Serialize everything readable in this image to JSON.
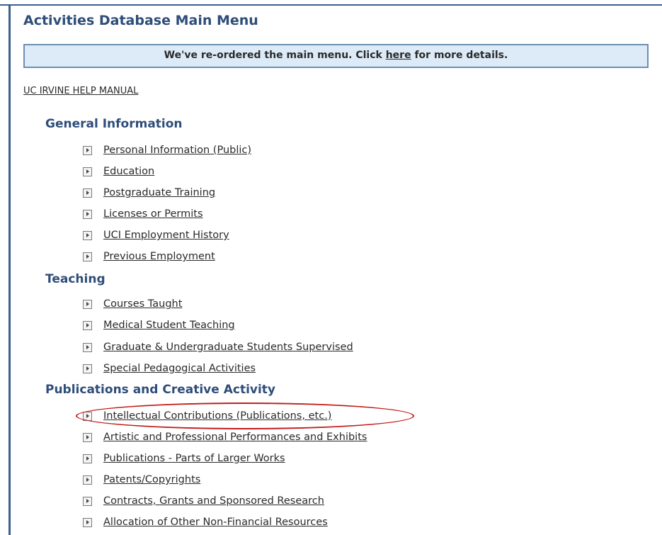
{
  "page": {
    "title": "Activities Database Main Menu"
  },
  "notice": {
    "text_before": "We've re-ordered the main menu. Click ",
    "link_label": "here",
    "text_after": " for more details."
  },
  "manual_link": {
    "label": "UC IRVINE HELP MANUAL"
  },
  "sections": [
    {
      "heading": "General Information",
      "items": [
        {
          "label": "Personal Information (Public)",
          "icon": "arrow-right-icon"
        },
        {
          "label": "Education",
          "icon": "arrow-right-icon"
        },
        {
          "label": "Postgraduate Training",
          "icon": "arrow-right-icon"
        },
        {
          "label": "Licenses or Permits",
          "icon": "arrow-right-icon"
        },
        {
          "label": "UCI Employment History",
          "icon": "arrow-right-icon"
        },
        {
          "label": "Previous Employment",
          "icon": "arrow-right-icon"
        }
      ]
    },
    {
      "heading": "Teaching",
      "items": [
        {
          "label": "Courses Taught",
          "icon": "arrow-right-icon"
        },
        {
          "label": "Medical Student Teaching",
          "icon": "arrow-right-icon"
        },
        {
          "label": "Graduate & Undergraduate Students Supervised",
          "icon": "arrow-right-icon"
        },
        {
          "label": "Special Pedagogical Activities",
          "icon": "arrow-right-icon"
        }
      ]
    },
    {
      "heading": "Publications and Creative Activity",
      "items": [
        {
          "label": "Intellectual Contributions (Publications, etc.)",
          "icon": "arrow-right-icon",
          "highlighted": true
        },
        {
          "label": "Artistic and Professional Performances and Exhibits",
          "icon": "arrow-right-icon"
        },
        {
          "label": "Publications - Parts of Larger Works",
          "icon": "arrow-right-icon"
        },
        {
          "label": "Patents/Copyrights",
          "icon": "arrow-right-icon"
        },
        {
          "label": "Contracts, Grants and Sponsored Research",
          "icon": "arrow-right-icon"
        },
        {
          "label": "Allocation of Other Non-Financial Resources",
          "icon": "arrow-right-icon"
        }
      ]
    }
  ],
  "colors": {
    "heading": "#2e4d79",
    "notice_background": "#dcebf7",
    "notice_border": "#6c8fb3",
    "highlight_ring": "#c21c1c"
  }
}
